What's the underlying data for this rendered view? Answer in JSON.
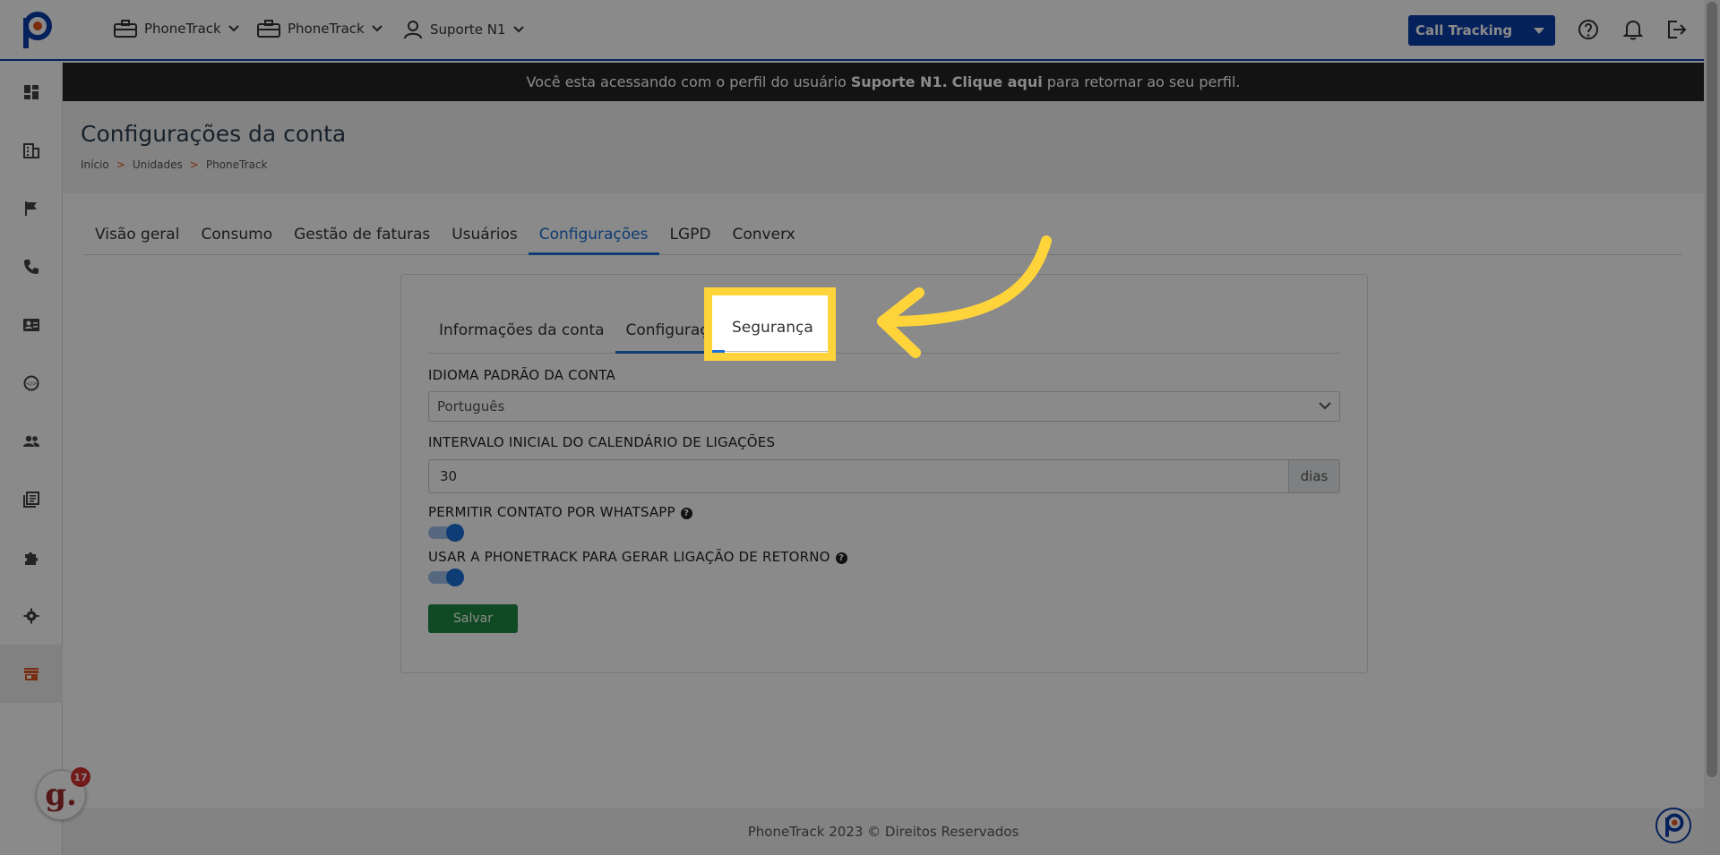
{
  "topbar": {
    "menus": [
      {
        "label": "PhoneTrack",
        "icon": "briefcase-icon"
      },
      {
        "label": "PhoneTrack",
        "icon": "briefcase-icon"
      },
      {
        "label": "Suporte N1",
        "icon": "user-icon"
      }
    ],
    "product_select": "Call Tracking"
  },
  "banner": {
    "prefix": "Você esta acessando com o perfil do usuário",
    "user": "Suporte N1.",
    "link": "Clique aqui",
    "suffix": "para retornar ao seu perfil."
  },
  "header": {
    "title": "Configurações da conta",
    "breadcrumb": [
      "Início",
      "Unidades",
      "PhoneTrack"
    ],
    "breadcrumb_sep": ">"
  },
  "main_tabs": [
    "Visão geral",
    "Consumo",
    "Gestão de faturas",
    "Usuários",
    "Configurações",
    "LGPD",
    "Converx"
  ],
  "sub_tabs": [
    "Informações da conta",
    "Configurações",
    "Segurança"
  ],
  "form": {
    "language_label": "IDIOMA PADRÃO DA CONTA",
    "language_value": "Português",
    "interval_label": "INTERVALO INICIAL DO CALENDÁRIO DE LIGAÇÕES",
    "interval_value": "30",
    "interval_unit": "dias",
    "whatsapp_label": "PERMITIR CONTATO POR WHATSAPP",
    "callback_label": "USAR A PHONETRACK PARA GERAR LIGAÇÃO DE RETORNO",
    "help_glyph": "?",
    "save_label": "Salvar"
  },
  "footer": {
    "text": "PhoneTrack 2023 © Direitos Reservados"
  },
  "chat": {
    "glyph": "g.",
    "badge": "17"
  },
  "colors": {
    "brand": "#0b3ea8",
    "accent": "#e2541b",
    "active_tab": "#1b6fd6",
    "save": "#1f8a43",
    "highlight": "#ffd43b"
  }
}
